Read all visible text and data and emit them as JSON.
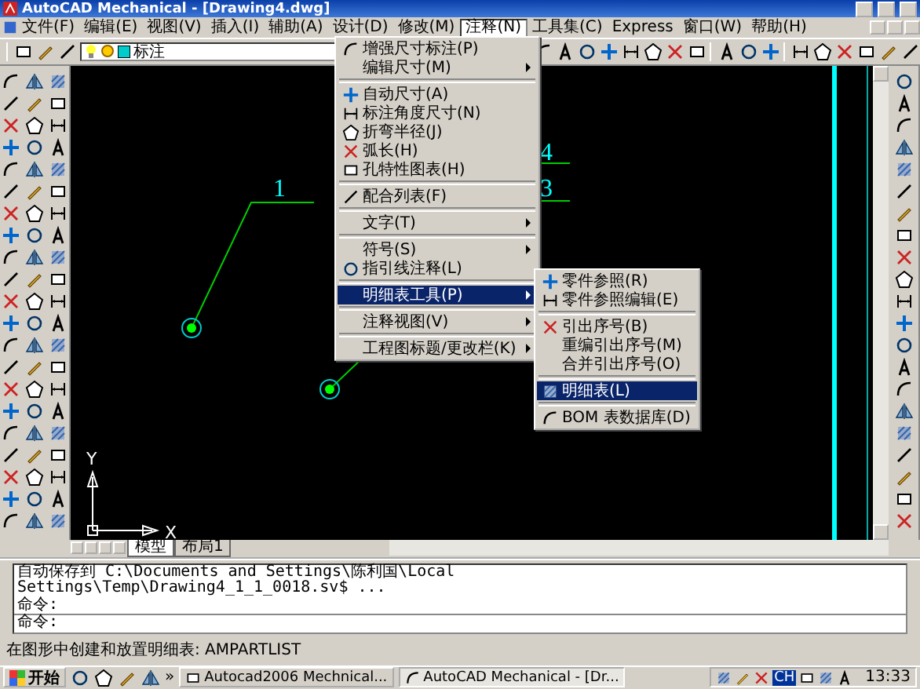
{
  "window": {
    "title": "AutoCAD Mechanical - [Drawing4.dwg]"
  },
  "menubar": [
    {
      "label": "文件(F)",
      "selected": false
    },
    {
      "label": "编辑(E)",
      "selected": false
    },
    {
      "label": "视图(V)",
      "selected": false
    },
    {
      "label": "插入(I)",
      "selected": false
    },
    {
      "label": "辅助(A)",
      "selected": false
    },
    {
      "label": "设计(D)",
      "selected": false
    },
    {
      "label": "修改(M)",
      "selected": false
    },
    {
      "label": "注释(N)",
      "selected": true
    },
    {
      "label": "工具集(C)",
      "selected": false
    },
    {
      "label": "Express",
      "selected": false
    },
    {
      "label": "窗口(W)",
      "selected": false
    },
    {
      "label": "帮助(H)",
      "selected": false
    }
  ],
  "layer_control": {
    "value": "标注"
  },
  "annotation_menu": [
    {
      "kind": "item",
      "label": "增强尺寸标注(P)",
      "has_icon": true,
      "submenu": false,
      "selected": false
    },
    {
      "kind": "item",
      "label": "编辑尺寸(M)",
      "has_icon": false,
      "submenu": true,
      "selected": false
    },
    {
      "kind": "separator"
    },
    {
      "kind": "item",
      "label": "自动尺寸(A)",
      "has_icon": true,
      "submenu": false,
      "selected": false
    },
    {
      "kind": "item",
      "label": "标注角度尺寸(N)",
      "has_icon": true,
      "submenu": false,
      "selected": false
    },
    {
      "kind": "item",
      "label": "折弯半径(J)",
      "has_icon": true,
      "submenu": false,
      "selected": false
    },
    {
      "kind": "item",
      "label": "弧长(H)",
      "has_icon": true,
      "submenu": false,
      "selected": false
    },
    {
      "kind": "item",
      "label": "孔特性图表(H)",
      "has_icon": true,
      "submenu": false,
      "selected": false
    },
    {
      "kind": "separator"
    },
    {
      "kind": "item",
      "label": "配合列表(F)",
      "has_icon": true,
      "submenu": false,
      "selected": false
    },
    {
      "kind": "separator"
    },
    {
      "kind": "item",
      "label": "文字(T)",
      "has_icon": false,
      "submenu": true,
      "selected": false
    },
    {
      "kind": "separator"
    },
    {
      "kind": "item",
      "label": "符号(S)",
      "has_icon": false,
      "submenu": true,
      "selected": false
    },
    {
      "kind": "item",
      "label": "指引线注释(L)",
      "has_icon": true,
      "submenu": false,
      "selected": false
    },
    {
      "kind": "separator"
    },
    {
      "kind": "item",
      "label": "明细表工具(P)",
      "has_icon": false,
      "submenu": true,
      "selected": true
    },
    {
      "kind": "separator"
    },
    {
      "kind": "item",
      "label": "注释视图(V)",
      "has_icon": false,
      "submenu": true,
      "selected": false
    },
    {
      "kind": "separator"
    },
    {
      "kind": "item",
      "label": "工程图标题/更改栏(K)",
      "has_icon": false,
      "submenu": true,
      "selected": false
    }
  ],
  "parts_list_submenu": [
    {
      "kind": "item",
      "label": "零件参照(R)",
      "has_icon": true,
      "selected": false
    },
    {
      "kind": "item",
      "label": "零件参照编辑(E)",
      "has_icon": true,
      "selected": false
    },
    {
      "kind": "separator"
    },
    {
      "kind": "item",
      "label": "引出序号(B)",
      "has_icon": true,
      "selected": false
    },
    {
      "kind": "item",
      "label": "重编引出序号(M)",
      "has_icon": false,
      "selected": false
    },
    {
      "kind": "item",
      "label": "合并引出序号(O)",
      "has_icon": false,
      "selected": false
    },
    {
      "kind": "separator"
    },
    {
      "kind": "item",
      "label": "明细表(L)",
      "has_icon": true,
      "selected": true
    },
    {
      "kind": "separator"
    },
    {
      "kind": "item",
      "label": "BOM 表数据库(D)",
      "has_icon": true,
      "selected": false
    }
  ],
  "drawing": {
    "balloons": [
      "1",
      "4",
      "3"
    ],
    "ucs": {
      "x_label": "X",
      "y_label": "Y"
    }
  },
  "layout_tabs": [
    {
      "label": "模型",
      "selected": true
    },
    {
      "label": "布局1",
      "selected": false
    }
  ],
  "command_history": [
    "自动保存到 C:\\Documents and Settings\\陈利国\\Local",
    "Settings\\Temp\\Drawing4_1_1_0018.sv$ ...",
    "命令:"
  ],
  "command_prompt": "命令:",
  "status_bar": "在图形中创建和放置明细表:  AMPARTLIST",
  "taskbar": {
    "start": "开始",
    "more": "»",
    "tasks": [
      {
        "label": "Autocad2006 Mechnical...",
        "selected": false
      },
      {
        "label": "AutoCAD Mechanical - [Dr...",
        "selected": true
      }
    ],
    "language": "CH",
    "clock": "13:33"
  }
}
